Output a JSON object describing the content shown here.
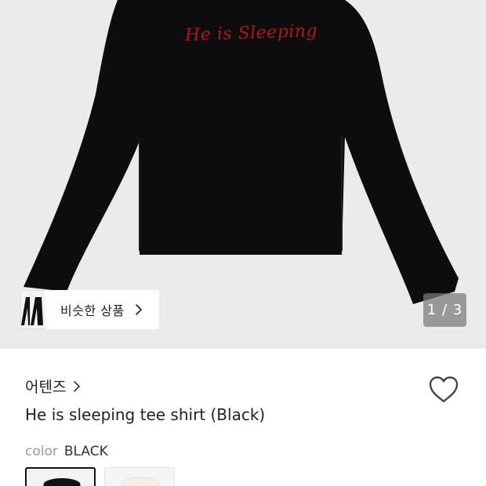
{
  "hero": {
    "embroidery_text": "He is Sleeping",
    "similar_products": {
      "label": "비슷한 상품",
      "chevron_icon": "chevron-right-icon"
    },
    "image_counter": "1 / 3"
  },
  "product": {
    "brand": "어텐즈",
    "brand_chevron_icon": "chevron-right-icon",
    "wishlist_icon": "heart-outline-icon",
    "title": "He is sleeping tee shirt (Black)",
    "color": {
      "label": "color",
      "value": "BLACK"
    },
    "swatches": [
      {
        "color": "#111111",
        "selected": true
      },
      {
        "color": "#f2f0ea",
        "selected": false
      }
    ]
  },
  "colors": {
    "background_hero": "#ebebeb",
    "shirt": "#0d0d0d",
    "embroidery": "#b3141e",
    "text_primary": "#222222",
    "text_muted": "#9a9a9a"
  }
}
